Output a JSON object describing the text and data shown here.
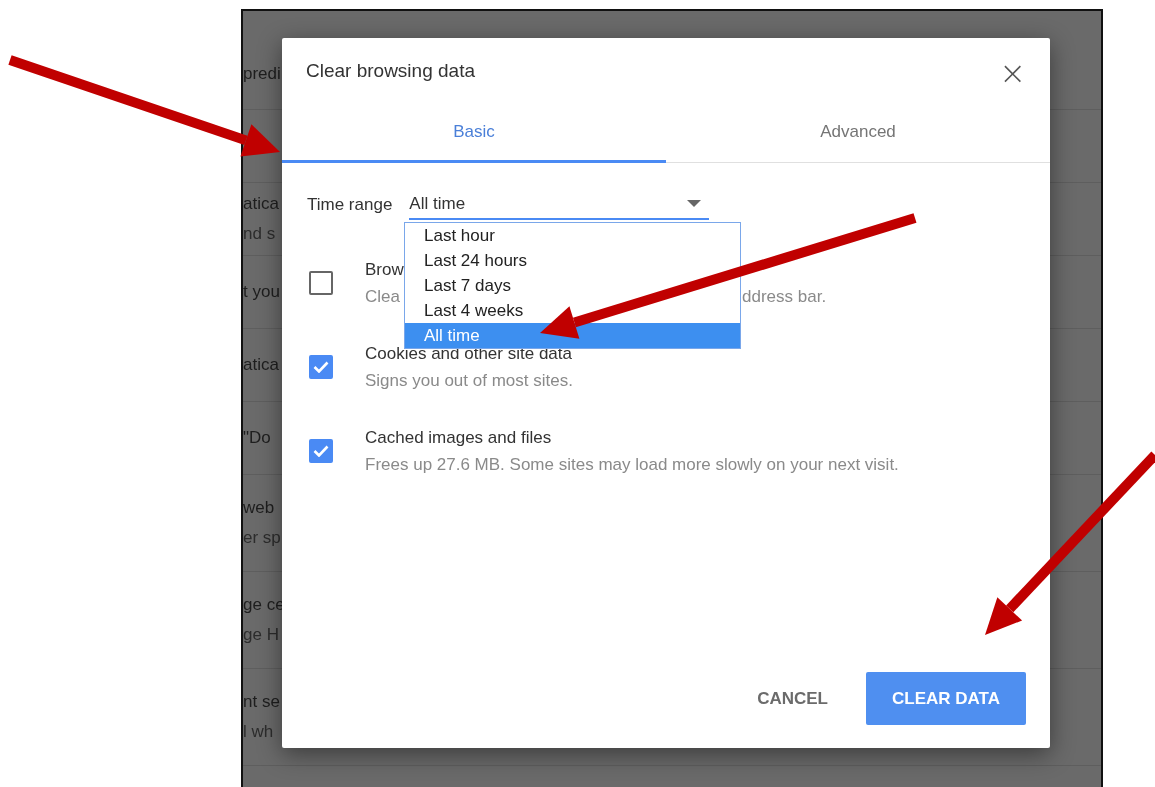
{
  "background_rows": [
    {
      "kind": "single",
      "lines": [
        "predi"
      ]
    },
    {
      "kind": "single"
    },
    {
      "kind": "single",
      "lines": [
        "atica",
        "nd s"
      ]
    },
    {
      "kind": "single",
      "lines": [
        "t you"
      ]
    },
    {
      "kind": "single",
      "lines": [
        "atica"
      ]
    },
    {
      "kind": "single",
      "lines": [
        "\"Do"
      ]
    },
    {
      "kind": "double",
      "lines": [
        "web",
        "er sp"
      ]
    },
    {
      "kind": "double",
      "lines": [
        "ge ce",
        "ge H"
      ]
    },
    {
      "kind": "double",
      "lines": [
        "nt se",
        "l wh"
      ]
    }
  ],
  "dialog": {
    "title": "Clear browsing data",
    "close": "×",
    "tabs": [
      {
        "label": "Basic",
        "selected": true
      },
      {
        "label": "Advanced",
        "selected": false
      }
    ],
    "time_range": {
      "label": "Time range",
      "value": "All time",
      "options": [
        {
          "label": "Last hour",
          "selected": false
        },
        {
          "label": "Last 24 hours",
          "selected": false
        },
        {
          "label": "Last 7 days",
          "selected": false
        },
        {
          "label": "Last 4 weeks",
          "selected": false
        },
        {
          "label": "All time",
          "selected": true
        }
      ]
    },
    "items": [
      {
        "title": "Brow",
        "description": [
          "Clea",
          "ddress bar."
        ],
        "checked": false
      },
      {
        "title": "Cookies and other site data",
        "description": [
          "Signs you out of most sites."
        ],
        "checked": true
      },
      {
        "title": "Cached images and files",
        "description": [
          "Frees up 27.6 MB. Some sites may load more slowly on your next visit."
        ],
        "checked": true
      }
    ],
    "buttons": [
      {
        "label": "CANCEL",
        "kind": "text"
      },
      {
        "label": "CLEAR DATA",
        "kind": "primary"
      }
    ]
  }
}
